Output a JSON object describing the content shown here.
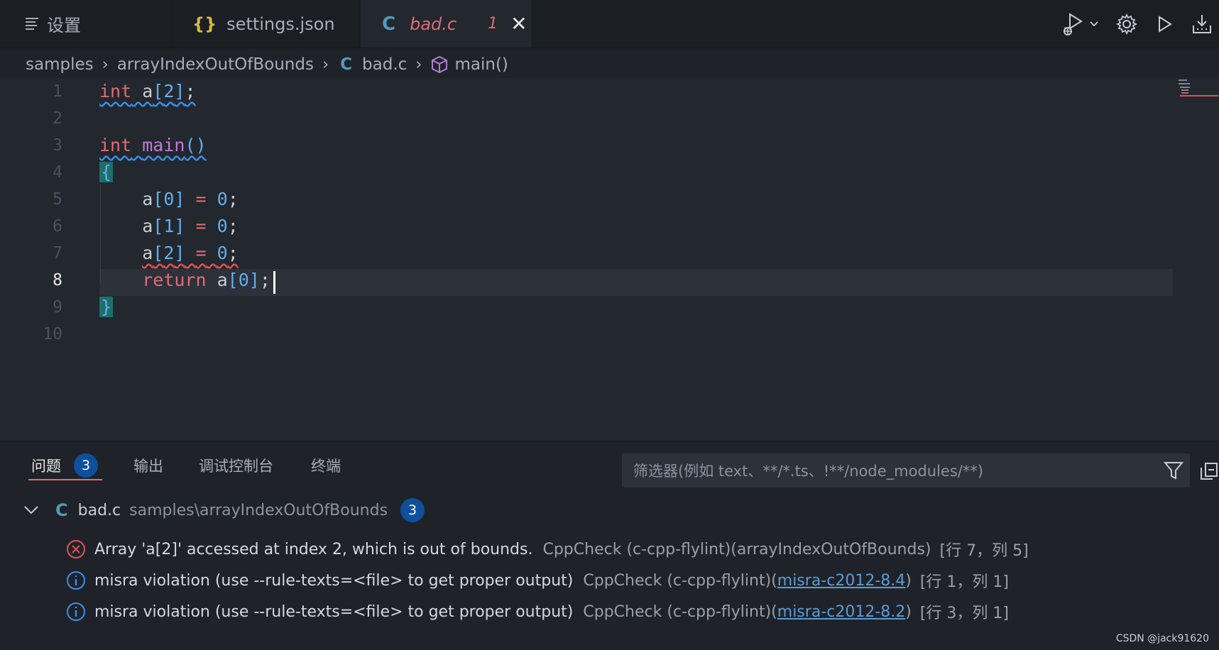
{
  "tabs": [
    {
      "label": "设置",
      "icon": "settings-list-icon"
    },
    {
      "label": "settings.json",
      "icon_text": "{}"
    },
    {
      "label": "bad.c",
      "icon_text": "C",
      "problem_count": "1",
      "close": "✕"
    }
  ],
  "breadcrumb": {
    "folder1": "samples",
    "folder2": "arrayIndexOutOfBounds",
    "file_icon": "C",
    "file": "bad.c",
    "symbol": "main()"
  },
  "editor": {
    "line_numbers": [
      "1",
      "2",
      "3",
      "4",
      "5",
      "6",
      "7",
      "8",
      "9",
      "10"
    ],
    "current_line": "8"
  },
  "panel": {
    "tabs": {
      "problems": "问题",
      "problems_count": "3",
      "output": "输出",
      "debug_console": "调试控制台",
      "terminal": "终端"
    },
    "filter_placeholder": "筛选器(例如 text、**/*.ts、!**/node_modules/**)",
    "file": {
      "icon": "C",
      "name": "bad.c",
      "path": "samples\\arrayIndexOutOfBounds",
      "count": "3"
    },
    "problems": [
      {
        "severity": "error",
        "message": "Array 'a[2]' accessed at index 2, which is out of bounds.",
        "source": "CppCheck (c-cpp-flylint)(arrayIndexOutOfBounds)",
        "position": "[行 7，列 5]"
      },
      {
        "severity": "info",
        "message": "misra violation (use --rule-texts=<file> to get proper output)",
        "source": "CppCheck (c-cpp-flylint)(",
        "link": "misra-c2012-8.4",
        "source_end": ")",
        "position": "[行 1，列 1]"
      },
      {
        "severity": "info",
        "message": "misra violation (use --rule-texts=<file> to get proper output)",
        "source": "CppCheck (c-cpp-flylint)(",
        "link": "misra-c2012-8.2",
        "source_end": ")",
        "position": "[行 3，列 1]"
      }
    ]
  },
  "watermark": "CSDN @jack91620",
  "colors": {
    "error": "#e05252",
    "info": "#3b8eea",
    "badge": "#0e4f9e",
    "modified_tab": "#e06c75"
  }
}
